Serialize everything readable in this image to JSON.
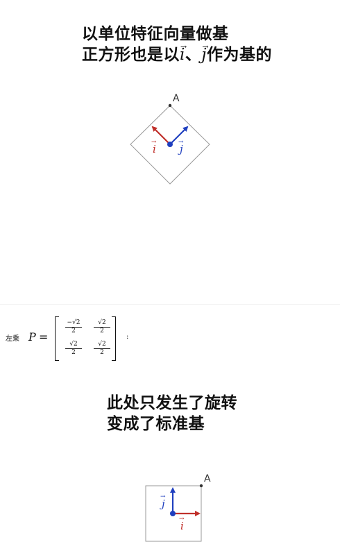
{
  "captions": {
    "top": {
      "line1": "以单位特征向量做基",
      "line2_prefix": "正方形也是以",
      "line2_i": "i",
      "line2_sep": "、",
      "line2_j": "j",
      "line2_suffix": "作为基的"
    },
    "bottom": {
      "line1": "此处只发生了旋转",
      "line2": "变成了标准基"
    }
  },
  "diagram_top": {
    "point_label": "A",
    "vector_i_label": "i",
    "vector_j_label": "j",
    "vector_i_color": "#c0302b",
    "vector_j_color": "#1f3fbf",
    "origin_color": "#1f3fbf",
    "square_color": "#999999"
  },
  "formula": {
    "prefix": "左乘",
    "matrix_name": "P",
    "equals": "=",
    "matrix": [
      [
        {
          "num": "−√2",
          "den": "2"
        },
        {
          "num": "√2",
          "den": "2"
        }
      ],
      [
        {
          "num": "√2",
          "den": "2"
        },
        {
          "num": "√2",
          "den": "2"
        }
      ]
    ],
    "suffix": ":"
  },
  "diagram_bottom": {
    "point_label": "A",
    "vector_i_label": "i",
    "vector_j_label": "j",
    "vector_i_color": "#c0302b",
    "vector_j_color": "#1f3fbf",
    "origin_color": "#1f3fbf",
    "square_color": "#999999"
  }
}
